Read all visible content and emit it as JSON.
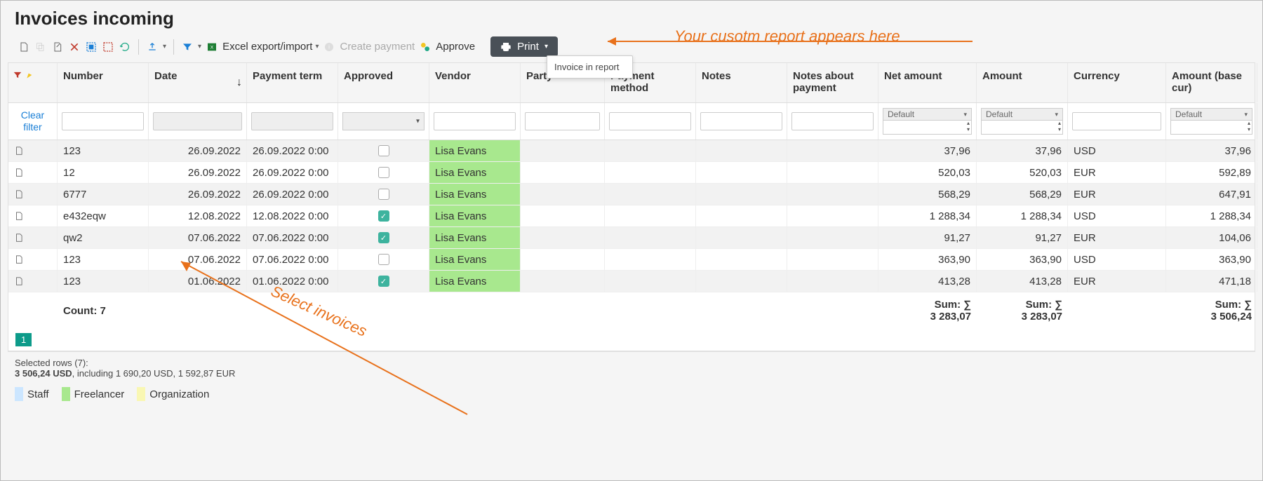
{
  "title": "Invoices incoming",
  "toolbar": {
    "excel_label": "Excel export/import",
    "create_payment": "Create payment",
    "approve": "Approve",
    "print": "Print"
  },
  "print_menu_item": "Invoice in report",
  "columns": [
    "",
    "Number",
    "Date",
    "Payment term",
    "Approved",
    "Vendor",
    "Party",
    "Payment method",
    "Notes",
    "Notes about payment",
    "Net amount",
    "Amount",
    "Currency",
    "Amount (base cur)"
  ],
  "clear_filter": "Clear filter",
  "num_default": "Default",
  "rows": [
    {
      "num": "123",
      "date": "26.09.2022",
      "term": "26.09.2022 0:00",
      "appr": false,
      "vendor": "Lisa Evans",
      "net": "37,96",
      "amt": "37,96",
      "cur": "USD",
      "base": "37,96"
    },
    {
      "num": "12",
      "date": "26.09.2022",
      "term": "26.09.2022 0:00",
      "appr": false,
      "vendor": "Lisa Evans",
      "net": "520,03",
      "amt": "520,03",
      "cur": "EUR",
      "base": "592,89"
    },
    {
      "num": "6777",
      "date": "26.09.2022",
      "term": "26.09.2022 0:00",
      "appr": false,
      "vendor": "Lisa Evans",
      "net": "568,29",
      "amt": "568,29",
      "cur": "EUR",
      "base": "647,91"
    },
    {
      "num": "e432eqw",
      "date": "12.08.2022",
      "term": "12.08.2022 0:00",
      "appr": true,
      "vendor": "Lisa Evans",
      "net": "1 288,34",
      "amt": "1 288,34",
      "cur": "USD",
      "base": "1 288,34"
    },
    {
      "num": "qw2",
      "date": "07.06.2022",
      "term": "07.06.2022 0:00",
      "appr": true,
      "vendor": "Lisa Evans",
      "net": "91,27",
      "amt": "91,27",
      "cur": "EUR",
      "base": "104,06"
    },
    {
      "num": "123",
      "date": "07.06.2022",
      "term": "07.06.2022 0:00",
      "appr": false,
      "vendor": "Lisa Evans",
      "net": "363,90",
      "amt": "363,90",
      "cur": "USD",
      "base": "363,90"
    },
    {
      "num": "123",
      "date": "01.06.2022",
      "term": "01.06.2022 0:00",
      "appr": true,
      "vendor": "Lisa Evans",
      "net": "413,28",
      "amt": "413,28",
      "cur": "EUR",
      "base": "471,18"
    }
  ],
  "totals": {
    "count_label": "Count: 7",
    "sum_label": "Sum: ∑",
    "net_sum": "3 283,07",
    "amt_sum": "3 283,07",
    "base_sum": "3 506,24"
  },
  "pager_current": "1",
  "status": {
    "line1": "Selected rows (7):",
    "total": "3 506,24 USD",
    "breakdown": ", including 1 690,20 USD, 1 592,87 EUR"
  },
  "legend": {
    "staff": "Staff",
    "freelancer": "Freelancer",
    "org": "Organization"
  },
  "annotations": {
    "report": "Your cusotm report appears here",
    "select": "Select invoices"
  }
}
